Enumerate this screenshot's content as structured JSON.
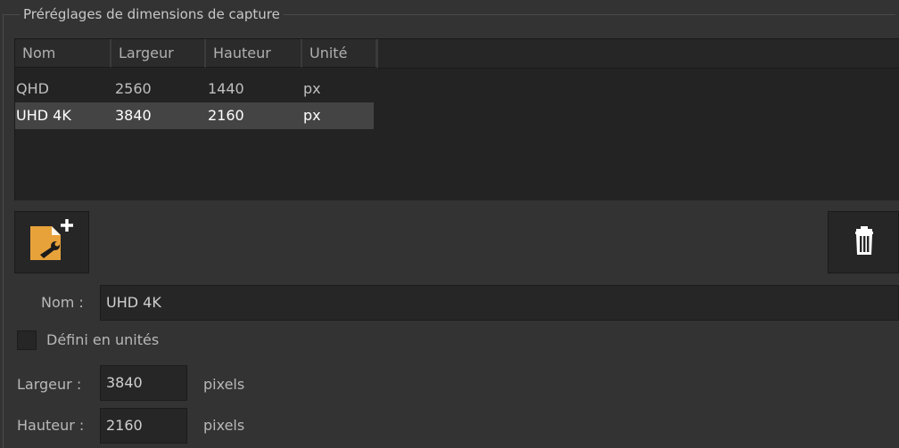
{
  "group": {
    "title": "Préréglages de dimensions de capture"
  },
  "list": {
    "columns": [
      "Nom",
      "Largeur",
      "Hauteur",
      "Unité"
    ],
    "rows": [
      {
        "nom": "QHD",
        "largeur": "2560",
        "hauteur": "1440",
        "unite": "px",
        "selected": false
      },
      {
        "nom": "UHD 4K",
        "largeur": "3840",
        "hauteur": "2160",
        "unite": "px",
        "selected": true
      }
    ]
  },
  "toolbar": {
    "add_icon": "add-preset-icon",
    "delete_icon": "trash-icon"
  },
  "form": {
    "name_label": "Nom :",
    "name_value": "UHD 4K",
    "units_checkbox_label": "Défini en unités",
    "units_checked": false,
    "width_label": "Largeur :",
    "width_value": "3840",
    "width_unit": "pixels",
    "height_label": "Hauteur :",
    "height_value": "2160",
    "height_unit": "pixels"
  },
  "colors": {
    "background": "#333333",
    "list_bg": "#232323",
    "selected_row": "#444444",
    "icon_accent": "#e8a23a"
  }
}
